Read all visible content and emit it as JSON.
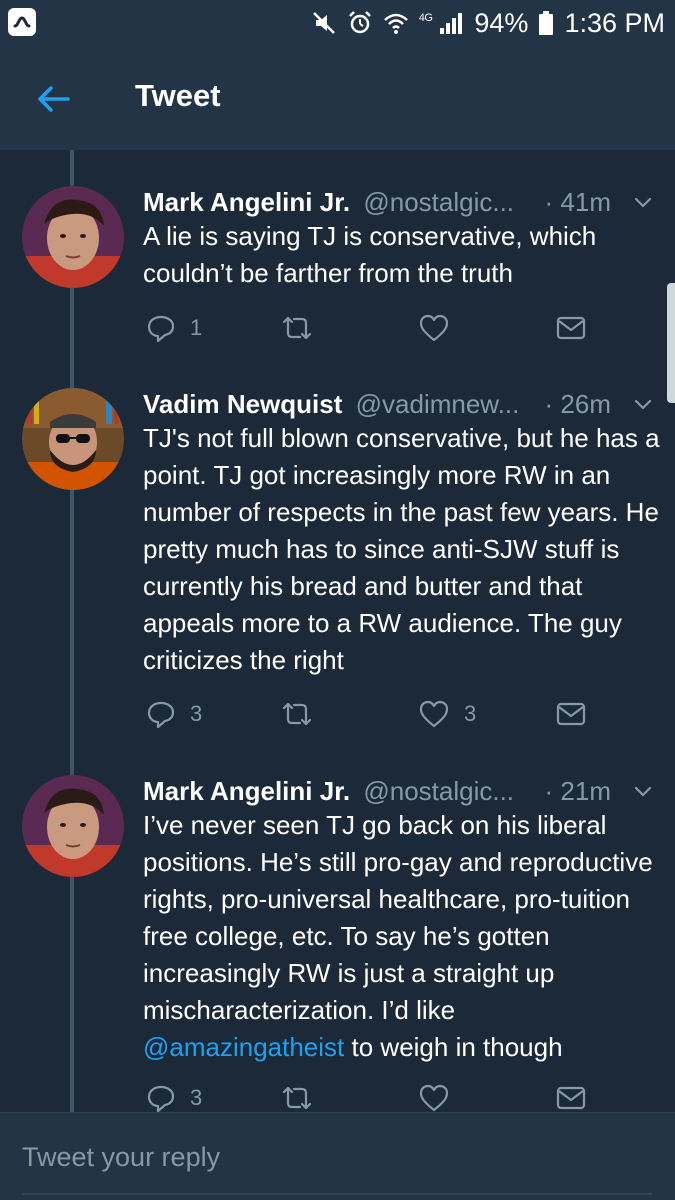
{
  "status_bar": {
    "network": "4G",
    "battery": "94%",
    "time": "1:36 PM"
  },
  "header": {
    "title": "Tweet"
  },
  "tweets": [
    {
      "name": "Mark Angelini Jr.",
      "handle": "@nostalgic...",
      "time": "· 41m",
      "text_parts": [
        "A lie is saying TJ is conservative, which couldn’t be farther from the truth"
      ],
      "reply_count": "1",
      "retweet_count": "",
      "like_count": ""
    },
    {
      "name": "Vadim Newquist",
      "handle": "@vadimnew...",
      "time": "· 26m",
      "text_parts": [
        "TJ's not full blown conservative, but he has a point. TJ got increasingly more RW in an number of respects in the past few years. He pretty much has to since anti-SJW stuff is currently his bread and butter and that appeals more to a RW audience. The guy criticizes the right"
      ],
      "reply_count": "3",
      "retweet_count": "",
      "like_count": "3"
    },
    {
      "name": "Mark Angelini Jr.",
      "handle": "@nostalgic...",
      "time": "· 21m",
      "text_parts": [
        "I’ve never seen TJ go back on his liberal positions. He’s still pro-gay and reproductive rights, pro-universal healthcare, pro-tuition free college, etc. To say he’s gotten increasingly RW is just a straight up mischaracterization. I’d like ",
        "@amazingatheist",
        " to weigh in though"
      ],
      "reply_count": "3",
      "retweet_count": "",
      "like_count": ""
    }
  ],
  "reply": {
    "placeholder": "Tweet your reply"
  },
  "colors": {
    "background": "#1c2938",
    "bar": "#243447",
    "accent": "#1da1f2",
    "muted": "#8899a6"
  },
  "icons": {
    "back": "arrow-left-icon",
    "reply": "reply-icon",
    "retweet": "retweet-icon",
    "like": "heart-icon",
    "dm": "envelope-icon",
    "more": "chevron-down-icon"
  }
}
